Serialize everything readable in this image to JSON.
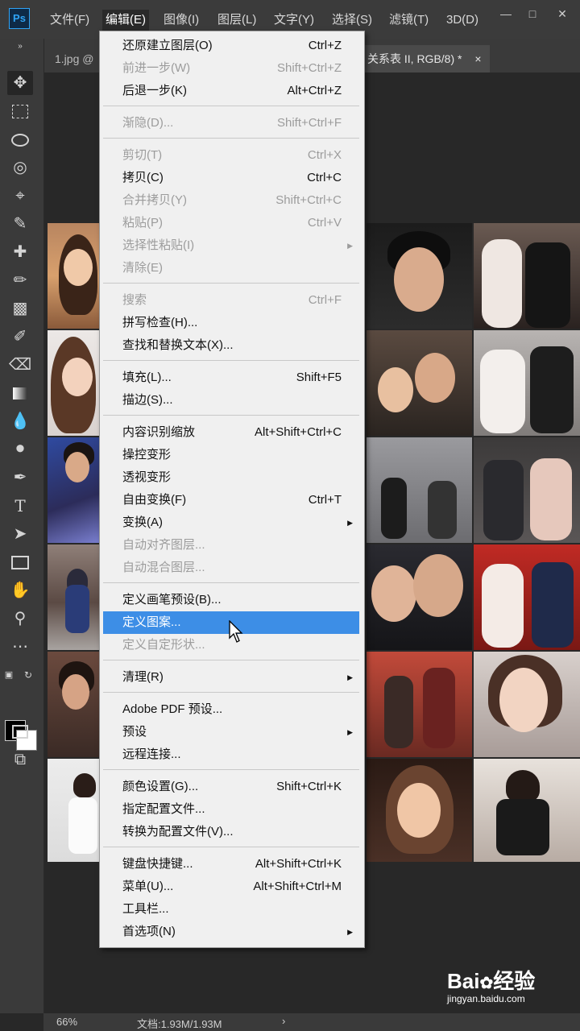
{
  "app": {
    "logo": "Ps"
  },
  "menubar": {
    "items": [
      {
        "label": "文件(F)"
      },
      {
        "label": "编辑(E)"
      },
      {
        "label": "图像(I)"
      },
      {
        "label": "图层(L)"
      },
      {
        "label": "文字(Y)"
      },
      {
        "label": "选择(S)"
      },
      {
        "label": "滤镜(T)"
      },
      {
        "label": "3D(D)"
      }
    ],
    "active_index": 1
  },
  "tabs": {
    "left_tab": "1.jpg @",
    "right_tab": "关系表 II, RGB/8) *",
    "close_glyph": "×"
  },
  "edit_menu": {
    "items": [
      {
        "label": "还原建立图层(O)",
        "shortcut": "Ctrl+Z",
        "disabled": false
      },
      {
        "label": "前进一步(W)",
        "shortcut": "Shift+Ctrl+Z",
        "disabled": true
      },
      {
        "label": "后退一步(K)",
        "shortcut": "Alt+Ctrl+Z",
        "disabled": false
      },
      {
        "label": "渐隐(D)...",
        "shortcut": "Shift+Ctrl+F",
        "disabled": true
      },
      {
        "label": "剪切(T)",
        "shortcut": "Ctrl+X",
        "disabled": true
      },
      {
        "label": "拷贝(C)",
        "shortcut": "Ctrl+C",
        "disabled": false
      },
      {
        "label": "合并拷贝(Y)",
        "shortcut": "Shift+Ctrl+C",
        "disabled": true
      },
      {
        "label": "粘贴(P)",
        "shortcut": "Ctrl+V",
        "disabled": true
      },
      {
        "label": "选择性粘贴(I)",
        "shortcut": "",
        "disabled": true,
        "submenu": true
      },
      {
        "label": "清除(E)",
        "shortcut": "",
        "disabled": true
      },
      {
        "label": "搜索",
        "shortcut": "Ctrl+F",
        "disabled": true
      },
      {
        "label": "拼写检查(H)...",
        "shortcut": "",
        "disabled": false
      },
      {
        "label": "查找和替换文本(X)...",
        "shortcut": "",
        "disabled": false
      },
      {
        "label": "填充(L)...",
        "shortcut": "Shift+F5",
        "disabled": false
      },
      {
        "label": "描边(S)...",
        "shortcut": "",
        "disabled": false
      },
      {
        "label": "内容识别缩放",
        "shortcut": "Alt+Shift+Ctrl+C",
        "disabled": false
      },
      {
        "label": "操控变形",
        "shortcut": "",
        "disabled": false
      },
      {
        "label": "透视变形",
        "shortcut": "",
        "disabled": false
      },
      {
        "label": "自由变换(F)",
        "shortcut": "Ctrl+T",
        "disabled": false
      },
      {
        "label": "变换(A)",
        "shortcut": "",
        "disabled": false,
        "submenu": true
      },
      {
        "label": "自动对齐图层...",
        "shortcut": "",
        "disabled": true
      },
      {
        "label": "自动混合图层...",
        "shortcut": "",
        "disabled": true
      },
      {
        "label": "定义画笔预设(B)...",
        "shortcut": "",
        "disabled": false
      },
      {
        "label": "定义图案...",
        "shortcut": "",
        "disabled": false,
        "highlighted": true
      },
      {
        "label": "定义自定形状...",
        "shortcut": "",
        "disabled": true
      },
      {
        "label": "清理(R)",
        "shortcut": "",
        "disabled": false,
        "submenu": true
      },
      {
        "label": "Adobe PDF 预设...",
        "shortcut": "",
        "disabled": false
      },
      {
        "label": "预设",
        "shortcut": "",
        "disabled": false,
        "submenu": true
      },
      {
        "label": "远程连接...",
        "shortcut": "",
        "disabled": false
      },
      {
        "label": "颜色设置(G)...",
        "shortcut": "Shift+Ctrl+K",
        "disabled": false
      },
      {
        "label": "指定配置文件...",
        "shortcut": "",
        "disabled": false
      },
      {
        "label": "转换为配置文件(V)...",
        "shortcut": "",
        "disabled": false
      },
      {
        "label": "键盘快捷键...",
        "shortcut": "Alt+Shift+Ctrl+K",
        "disabled": false
      },
      {
        "label": "菜单(U)...",
        "shortcut": "Alt+Shift+Ctrl+M",
        "disabled": false
      },
      {
        "label": "工具栏...",
        "shortcut": "",
        "disabled": false
      },
      {
        "label": "首选项(N)",
        "shortcut": "",
        "disabled": false,
        "submenu": true
      }
    ]
  },
  "status": {
    "zoom": "66%",
    "doc_info": "文档:1.93M/1.93M",
    "arrow": "›"
  },
  "watermark": {
    "brand": "Bai",
    "brand2": "经验",
    "url": "jingyan.baidu.com"
  },
  "colors": {
    "menu_highlight": "#3d8ee6",
    "menu_bg": "#f0f0f0",
    "toolbar_bg": "#3a3a3a",
    "menubar_bg": "#3b3b3b"
  }
}
